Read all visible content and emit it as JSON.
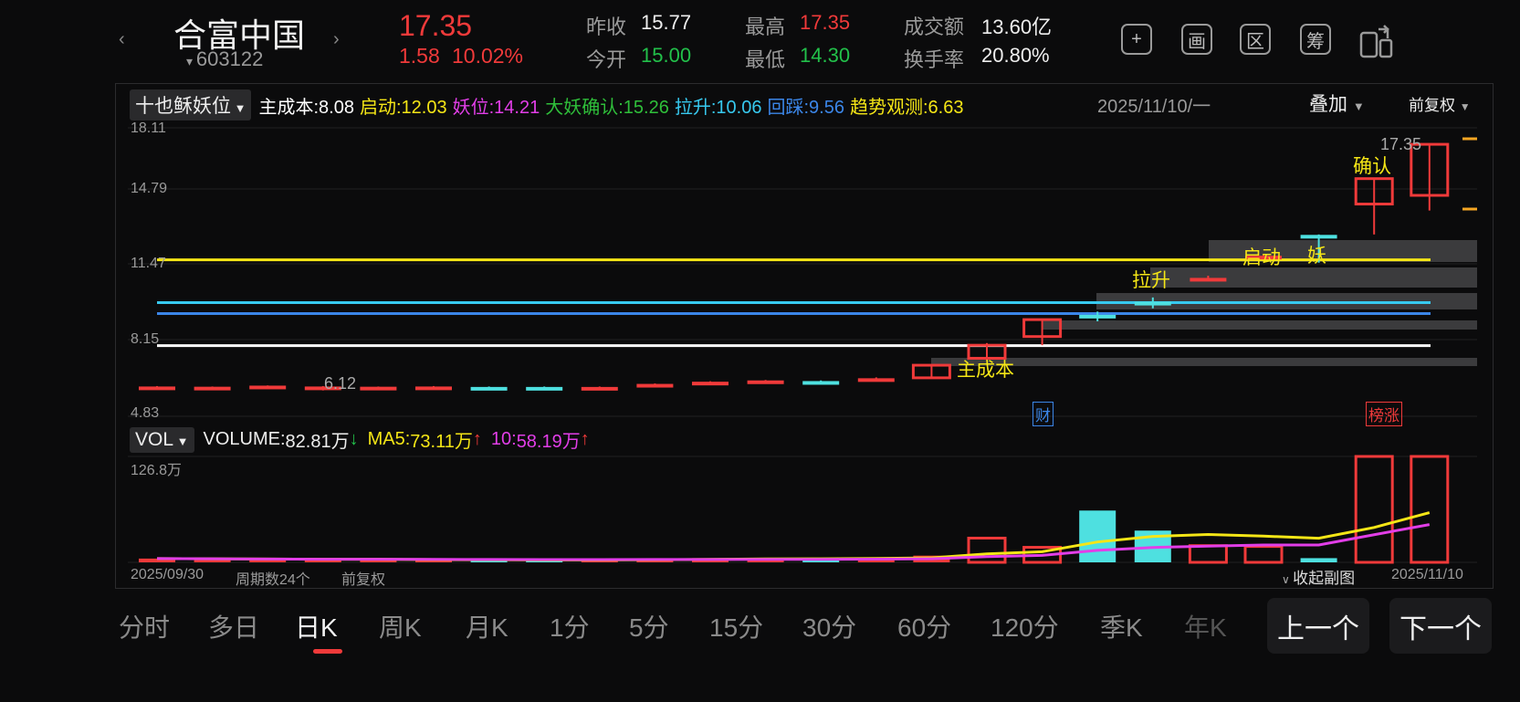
{
  "header": {
    "name": "合富中国",
    "code": "603122",
    "price": "17.35",
    "change": "1.58",
    "change_pct": "10.02%",
    "quote": [
      {
        "label": "昨收",
        "value": "15.77",
        "color": "white"
      },
      {
        "label": "今开",
        "value": "15.00",
        "color": "green"
      },
      {
        "label": "最高",
        "value": "17.35",
        "color": "red"
      },
      {
        "label": "最低",
        "value": "14.30",
        "color": "green"
      },
      {
        "label": "成交额",
        "value": "13.60亿",
        "color": "white"
      },
      {
        "label": "换手率",
        "value": "20.80%",
        "color": "white"
      }
    ],
    "tools": [
      "+",
      "画",
      "区",
      "筹"
    ]
  },
  "indicator": {
    "name": "十也稣妖位",
    "items": [
      {
        "label": "主成本:",
        "value": "8.08",
        "color": "#ffffff"
      },
      {
        "label": "启动:",
        "value": "12.03",
        "color": "#f5e616"
      },
      {
        "label": "妖位:",
        "value": "14.21",
        "color": "#e23ee8"
      },
      {
        "label": "大妖确认:",
        "value": "15.26",
        "color": "#2fbf3a"
      },
      {
        "label": "拉升:",
        "value": "10.06",
        "color": "#37c9ef"
      },
      {
        "label": "回踩:",
        "value": "9.56",
        "color": "#3b86e8"
      },
      {
        "label": "趋势观测:",
        "value": "6.63",
        "color": "#f5e616"
      }
    ],
    "date": "2025/11/10/一",
    "overlay": "叠加",
    "adjust": "前复权"
  },
  "price_axis": {
    "max": "18.11",
    "l2": "14.79",
    "l3": "11.47",
    "l4": "8.15",
    "min": "4.83"
  },
  "price_marks": {
    "low_label": "6.12",
    "high_label": "17.35"
  },
  "annotations": {
    "cost": "主成本",
    "pull": "拉升",
    "start": "启动",
    "demon": "妖",
    "confirm": "确认",
    "cai": "财",
    "bang": "榜涨"
  },
  "volume": {
    "name": "VOL",
    "vol_label": "VOLUME:",
    "vol_value": "82.81万",
    "vol_arrow": "↓",
    "ma5_label": "MA5:",
    "ma5_value": "73.11万",
    "ma5_arrow": "↑",
    "ma10_label": "10:",
    "ma10_value": "58.19万",
    "ma10_arrow": "↑",
    "max": "126.8万"
  },
  "footer_chart": {
    "start": "2025/09/30",
    "count": "周期数24个",
    "adjust": "前复权",
    "collapse": "收起副图",
    "end": "2025/11/10"
  },
  "periods": [
    "分时",
    "多日",
    "日K",
    "周K",
    "月K",
    "1分",
    "5分",
    "15分",
    "30分",
    "60分",
    "120分",
    "季K",
    "年K"
  ],
  "active_period": 2,
  "prev_btn": "上一个",
  "next_btn": "下一个",
  "colors": {
    "up": "#f03a3a",
    "down": "#4ee0e0",
    "bg": "#0b0b0c",
    "ma5": "#f5e616",
    "ma10": "#e23ee8"
  },
  "chart_data": {
    "type": "candlestick",
    "x": [
      "2025/09/30",
      "",
      "",
      "",
      "",
      "",
      "",
      "",
      "",
      "",
      "",
      "",
      "",
      "",
      "",
      "",
      "",
      "",
      "",
      "",
      "",
      "",
      "",
      "2025/11/10"
    ],
    "ohlc": [
      [
        6.2,
        6.22,
        6.15,
        6.2
      ],
      [
        6.18,
        6.2,
        6.12,
        6.19
      ],
      [
        6.21,
        6.25,
        6.18,
        6.24
      ],
      [
        6.1,
        6.22,
        6.02,
        6.2
      ],
      [
        6.18,
        6.2,
        6.14,
        6.19
      ],
      [
        6.16,
        6.22,
        6.14,
        6.2
      ],
      [
        6.18,
        6.2,
        6.14,
        6.17
      ],
      [
        6.18,
        6.2,
        6.04,
        6.06
      ],
      [
        6.06,
        6.2,
        6.05,
        6.18
      ],
      [
        6.2,
        6.34,
        6.18,
        6.32
      ],
      [
        6.3,
        6.44,
        6.28,
        6.42
      ],
      [
        6.4,
        6.5,
        6.38,
        6.48
      ],
      [
        6.45,
        6.48,
        6.38,
        6.4
      ],
      [
        6.5,
        6.62,
        6.48,
        6.58
      ],
      [
        6.6,
        7.2,
        6.58,
        7.18
      ],
      [
        7.5,
        8.2,
        7.4,
        8.1
      ],
      [
        8.5,
        9.3,
        8.1,
        9.28
      ],
      [
        9.5,
        9.65,
        9.2,
        9.45
      ],
      [
        10.1,
        10.3,
        9.8,
        10.05
      ],
      [
        11.2,
        11.3,
        11.05,
        11.2
      ],
      [
        12.2,
        12.25,
        12.18,
        12.22
      ],
      [
        13.18,
        13.2,
        11.9,
        13.16
      ],
      [
        14.6,
        15.8,
        13.2,
        15.77
      ],
      [
        15.0,
        17.35,
        14.3,
        17.35
      ]
    ],
    "volume_wan": [
      4.5,
      4.0,
      3.5,
      3.0,
      3.2,
      3.0,
      2.8,
      2.6,
      3.0,
      4.5,
      5.0,
      5.2,
      3.5,
      5.0,
      8.0,
      29.0,
      18.0,
      62.0,
      38.0,
      20.0,
      19.0,
      5.0,
      126.8,
      126.8,
      82.81
    ],
    "levels": {
      "主成本": 8.08,
      "启动": 12.03,
      "拉升": 10.06,
      "回踩": 9.56,
      "妖位": 14.21,
      "大妖确认": 15.26,
      "趋势观测": 6.63
    },
    "ylim": [
      4.83,
      18.11
    ],
    "volume_max_wan": 126.8
  }
}
